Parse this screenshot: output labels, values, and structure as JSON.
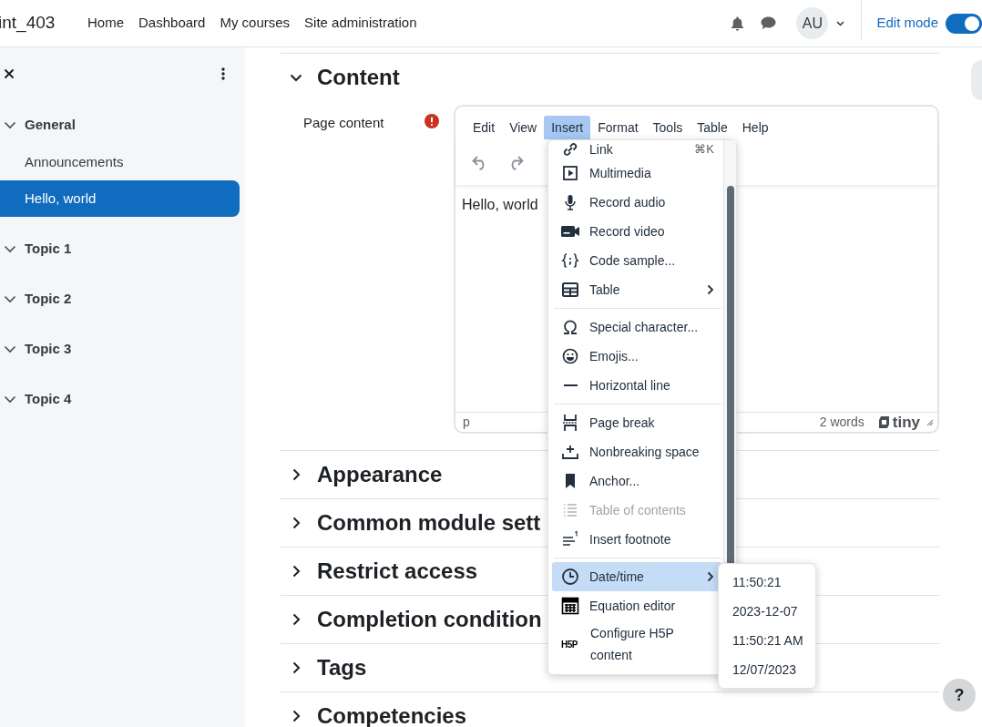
{
  "header": {
    "site_name": "int_403",
    "nav": [
      {
        "label": "Home"
      },
      {
        "label": "Dashboard"
      },
      {
        "label": "My courses"
      },
      {
        "label": "Site administration"
      }
    ],
    "avatar": "AU",
    "edit_mode": {
      "label": "Edit mode",
      "on": true
    }
  },
  "sidebar": {
    "sections": [
      {
        "title": "General",
        "expanded": true,
        "children": [
          {
            "label": "Announcements",
            "selected": false
          },
          {
            "label": "Hello, world",
            "selected": true
          }
        ]
      },
      {
        "title": "Topic 1",
        "expanded": true
      },
      {
        "title": "Topic 2",
        "expanded": true
      },
      {
        "title": "Topic 3",
        "expanded": true
      },
      {
        "title": "Topic 4",
        "expanded": true
      }
    ]
  },
  "form": {
    "sections": [
      {
        "title": "Content",
        "expanded": true
      },
      {
        "title": "Appearance",
        "expanded": false
      },
      {
        "title": "Common module sett",
        "expanded": false
      },
      {
        "title": "Restrict access",
        "expanded": false
      },
      {
        "title": "Completion condition",
        "expanded": false
      },
      {
        "title": "Tags",
        "expanded": false
      },
      {
        "title": "Competencies",
        "expanded": false
      }
    ],
    "field_label": "Page content",
    "required": true
  },
  "editor": {
    "menubar": [
      {
        "label": "Edit",
        "selected": false
      },
      {
        "label": "View",
        "selected": false
      },
      {
        "label": "Insert",
        "selected": true
      },
      {
        "label": "Format",
        "selected": false
      },
      {
        "label": "Tools",
        "selected": false
      },
      {
        "label": "Table",
        "selected": false
      },
      {
        "label": "Help",
        "selected": false
      }
    ],
    "content": "Hello, world",
    "path": "p",
    "word_count": "2 words",
    "branding": "tiny"
  },
  "insert_menu": {
    "groups": [
      [
        {
          "label": "Link",
          "shortcut": "⌘K",
          "submenu": false,
          "disabled": false,
          "selected": false
        },
        {
          "label": "Multimedia",
          "submenu": false,
          "disabled": false,
          "selected": false
        },
        {
          "label": "Record audio",
          "submenu": false,
          "disabled": false,
          "selected": false
        },
        {
          "label": "Record video",
          "submenu": false,
          "disabled": false,
          "selected": false
        },
        {
          "label": "Code sample...",
          "submenu": false,
          "disabled": false,
          "selected": false
        },
        {
          "label": "Table",
          "submenu": true,
          "disabled": false,
          "selected": false
        }
      ],
      [
        {
          "label": "Special character...",
          "submenu": false,
          "disabled": false,
          "selected": false
        },
        {
          "label": "Emojis...",
          "submenu": false,
          "disabled": false,
          "selected": false
        },
        {
          "label": "Horizontal line",
          "submenu": false,
          "disabled": false,
          "selected": false
        }
      ],
      [
        {
          "label": "Page break",
          "submenu": false,
          "disabled": false,
          "selected": false
        },
        {
          "label": "Nonbreaking space",
          "submenu": false,
          "disabled": false,
          "selected": false
        },
        {
          "label": "Anchor...",
          "submenu": false,
          "disabled": false,
          "selected": false
        },
        {
          "label": "Table of contents",
          "submenu": false,
          "disabled": true,
          "selected": false
        },
        {
          "label": "Insert footnote",
          "submenu": false,
          "disabled": false,
          "selected": false
        }
      ],
      [
        {
          "label": "Date/time",
          "submenu": true,
          "disabled": false,
          "selected": true
        },
        {
          "label": "Equation editor",
          "submenu": false,
          "disabled": false,
          "selected": false
        },
        {
          "label": "Configure H5P content",
          "logo_text": "H5P",
          "submenu": false,
          "disabled": false,
          "selected": false
        }
      ]
    ],
    "submenu": [
      "11:50:21",
      "2023-12-07",
      "11:50:21 AM",
      "12/07/2023"
    ]
  },
  "help": "?"
}
